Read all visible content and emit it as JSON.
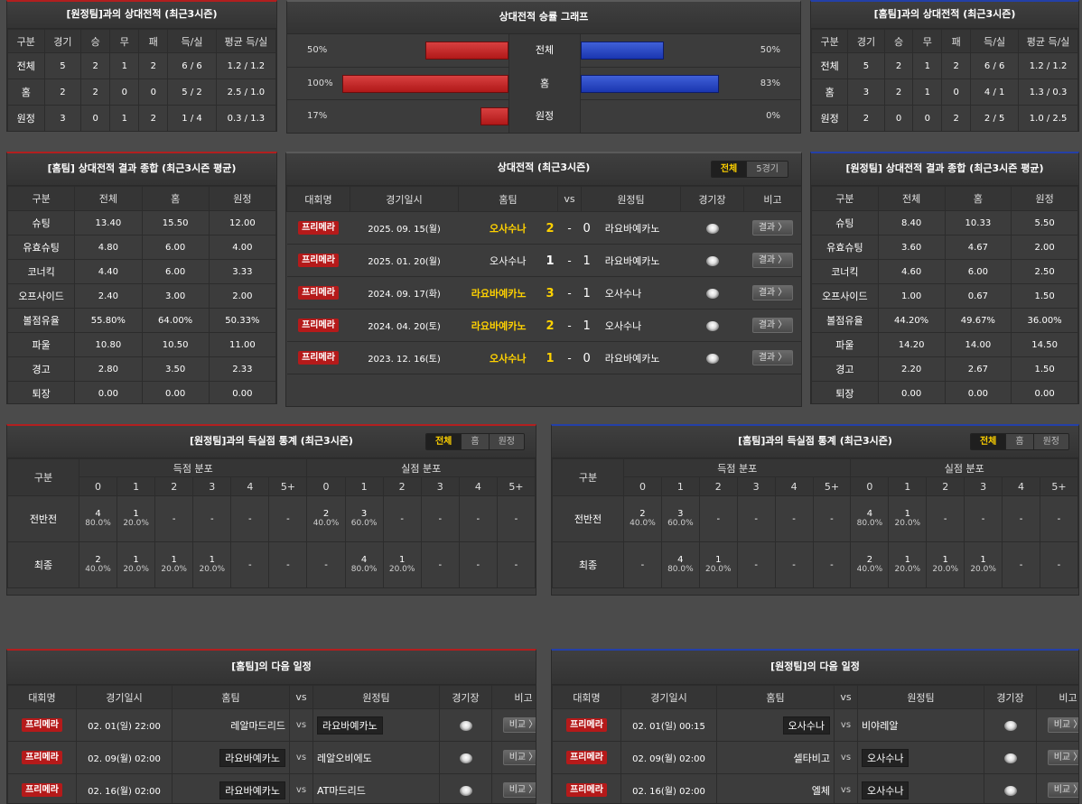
{
  "p1": {
    "title": "[원정팀]과의 상대전적 (최근3시즌)",
    "headers": [
      "구분",
      "경기",
      "승",
      "무",
      "패",
      "득/실",
      "평균 득/실"
    ],
    "rows": [
      [
        "전체",
        "5",
        "2",
        "1",
        "2",
        "6 / 6",
        "1.2 / 1.2"
      ],
      [
        "홈",
        "2",
        "2",
        "0",
        "0",
        "5 / 2",
        "2.5 / 1.0"
      ],
      [
        "원정",
        "3",
        "0",
        "1",
        "2",
        "1 / 4",
        "0.3 / 1.3"
      ]
    ]
  },
  "p2": {
    "title": "상대전적 승률 그래프",
    "rows": [
      {
        "label": "전체",
        "left": "50%",
        "right": "50%",
        "lv": 50,
        "rv": 50
      },
      {
        "label": "홈",
        "left": "100%",
        "right": "83%",
        "lv": 100,
        "rv": 83
      },
      {
        "label": "원정",
        "left": "17%",
        "right": "0%",
        "lv": 17,
        "rv": 0
      }
    ]
  },
  "p3": {
    "title": "[홈팀]과의 상대전적 (최근3시즌)",
    "headers": [
      "구분",
      "경기",
      "승",
      "무",
      "패",
      "득/실",
      "평균 득/실"
    ],
    "rows": [
      [
        "전체",
        "5",
        "2",
        "1",
        "2",
        "6 / 6",
        "1.2 / 1.2"
      ],
      [
        "홈",
        "3",
        "2",
        "1",
        "0",
        "4 / 1",
        "1.3 / 0.3"
      ],
      [
        "원정",
        "2",
        "0",
        "0",
        "2",
        "2 / 5",
        "1.0 / 2.5"
      ]
    ]
  },
  "p4": {
    "title": "[홈팀] 상대전적 결과 종합 (최근3시즌 평균)",
    "headers": [
      "구분",
      "전체",
      "홈",
      "원정"
    ],
    "rows": [
      [
        "슈팅",
        "13.40",
        "15.50",
        "12.00"
      ],
      [
        "유효슈팅",
        "4.80",
        "6.00",
        "4.00"
      ],
      [
        "코너킥",
        "4.40",
        "6.00",
        "3.33"
      ],
      [
        "오프사이드",
        "2.40",
        "3.00",
        "2.00"
      ],
      [
        "볼점유율",
        "55.80%",
        "64.00%",
        "50.33%"
      ],
      [
        "파울",
        "10.80",
        "10.50",
        "11.00"
      ],
      [
        "경고",
        "2.80",
        "3.50",
        "2.33"
      ],
      [
        "퇴장",
        "0.00",
        "0.00",
        "0.00"
      ]
    ]
  },
  "p5": {
    "title": "상대전적 (최근3시즌)",
    "tabs": [
      "전체",
      "5경기"
    ],
    "headers": [
      "대회명",
      "경기일시",
      "홈팀",
      "vs",
      "원정팀",
      "경기장",
      "비고"
    ],
    "rows": [
      {
        "league": "프리메라",
        "date": "2025. 09. 15(월)",
        "home": "오사수나",
        "score": "2",
        "dash": "-",
        "away_score": "0",
        "away": "라요바예카노",
        "home_win": true,
        "btn": "결과 〉"
      },
      {
        "league": "프리메라",
        "date": "2025. 01. 20(월)",
        "home": "오사수나",
        "score": "1",
        "dash": "-",
        "away_score": "1",
        "away": "라요바예카노",
        "home_win": false,
        "btn": "결과 〉"
      },
      {
        "league": "프리메라",
        "date": "2024. 09. 17(화)",
        "home": "라요바예카노",
        "score": "3",
        "dash": "-",
        "away_score": "1",
        "away": "오사수나",
        "home_win": true,
        "btn": "결과 〉"
      },
      {
        "league": "프리메라",
        "date": "2024. 04. 20(토)",
        "home": "라요바예카노",
        "score": "2",
        "dash": "-",
        "away_score": "1",
        "away": "오사수나",
        "home_win": true,
        "btn": "결과 〉"
      },
      {
        "league": "프리메라",
        "date": "2023. 12. 16(토)",
        "home": "오사수나",
        "score": "1",
        "dash": "-",
        "away_score": "0",
        "away": "라요바예카노",
        "home_win": true,
        "btn": "결과 〉"
      }
    ]
  },
  "p6": {
    "title": "[원정팀] 상대전적 결과 종합 (최근3시즌 평균)",
    "headers": [
      "구분",
      "전체",
      "홈",
      "원정"
    ],
    "rows": [
      [
        "슈팅",
        "8.40",
        "10.33",
        "5.50"
      ],
      [
        "유효슈팅",
        "3.60",
        "4.67",
        "2.00"
      ],
      [
        "코너킥",
        "4.60",
        "6.00",
        "2.50"
      ],
      [
        "오프사이드",
        "1.00",
        "0.67",
        "1.50"
      ],
      [
        "볼점유율",
        "44.20%",
        "49.67%",
        "36.00%"
      ],
      [
        "파울",
        "14.20",
        "14.00",
        "14.50"
      ],
      [
        "경고",
        "2.20",
        "2.67",
        "1.50"
      ],
      [
        "퇴장",
        "0.00",
        "0.00",
        "0.00"
      ]
    ]
  },
  "p7": {
    "title": "[원정팀]과의 득실점 통계 (최근3시즌)",
    "tabs": [
      "전체",
      "홈",
      "원정"
    ],
    "col0": "구분",
    "g1": "득점 분포",
    "g2": "실점 분포",
    "cols": [
      "0",
      "1",
      "2",
      "3",
      "4",
      "5+"
    ],
    "rows": [
      {
        "label": "전반전",
        "cells": [
          [
            "4",
            "80.0%"
          ],
          [
            "1",
            "20.0%"
          ],
          [
            "-",
            ""
          ],
          [
            "-",
            ""
          ],
          [
            "-",
            ""
          ],
          [
            "-",
            ""
          ],
          [
            "2",
            "40.0%"
          ],
          [
            "3",
            "60.0%"
          ],
          [
            "-",
            ""
          ],
          [
            "-",
            ""
          ],
          [
            "-",
            ""
          ],
          [
            "-",
            ""
          ]
        ]
      },
      {
        "label": "최종",
        "cells": [
          [
            "2",
            "40.0%"
          ],
          [
            "1",
            "20.0%"
          ],
          [
            "1",
            "20.0%"
          ],
          [
            "1",
            "20.0%"
          ],
          [
            "-",
            ""
          ],
          [
            "-",
            ""
          ],
          [
            "-",
            ""
          ],
          [
            "4",
            "80.0%"
          ],
          [
            "1",
            "20.0%"
          ],
          [
            "-",
            ""
          ],
          [
            "-",
            ""
          ],
          [
            "-",
            ""
          ]
        ]
      }
    ]
  },
  "p8": {
    "title": "[홈팀]과의 득실점 통계 (최근3시즌)",
    "tabs": [
      "전체",
      "홈",
      "원정"
    ],
    "col0": "구분",
    "g1": "득점 분포",
    "g2": "실점 분포",
    "cols": [
      "0",
      "1",
      "2",
      "3",
      "4",
      "5+"
    ],
    "rows": [
      {
        "label": "전반전",
        "cells": [
          [
            "2",
            "40.0%"
          ],
          [
            "3",
            "60.0%"
          ],
          [
            "-",
            ""
          ],
          [
            "-",
            ""
          ],
          [
            "-",
            ""
          ],
          [
            "-",
            ""
          ],
          [
            "4",
            "80.0%"
          ],
          [
            "1",
            "20.0%"
          ],
          [
            "-",
            ""
          ],
          [
            "-",
            ""
          ],
          [
            "-",
            ""
          ],
          [
            "-",
            ""
          ]
        ]
      },
      {
        "label": "최종",
        "cells": [
          [
            "-",
            ""
          ],
          [
            "4",
            "80.0%"
          ],
          [
            "1",
            "20.0%"
          ],
          [
            "-",
            ""
          ],
          [
            "-",
            ""
          ],
          [
            "-",
            ""
          ],
          [
            "2",
            "40.0%"
          ],
          [
            "1",
            "20.0%"
          ],
          [
            "1",
            "20.0%"
          ],
          [
            "1",
            "20.0%"
          ],
          [
            "-",
            ""
          ],
          [
            "-",
            ""
          ]
        ]
      }
    ]
  },
  "p9": {
    "title": "[홈팀]의 다음 일정",
    "headers": [
      "대회명",
      "경기일시",
      "홈팀",
      "vs",
      "원정팀",
      "경기장",
      "비고"
    ],
    "rows": [
      {
        "league": "프리메라",
        "date": "02. 01(일) 22:00",
        "home": "레알마드리드",
        "away": "라요바예카노",
        "mark": "away",
        "btn": "비교 〉"
      },
      {
        "league": "프리메라",
        "date": "02. 09(월) 02:00",
        "home": "라요바예카노",
        "away": "레알오비에도",
        "mark": "home",
        "btn": "비교 〉"
      },
      {
        "league": "프리메라",
        "date": "02. 16(월) 02:00",
        "home": "라요바예카노",
        "away": "AT마드리드",
        "mark": "home",
        "btn": "비교 〉"
      }
    ]
  },
  "p10": {
    "title": "[원정팀]의 다음 일정",
    "headers": [
      "대회명",
      "경기일시",
      "홈팀",
      "vs",
      "원정팀",
      "경기장",
      "비고"
    ],
    "rows": [
      {
        "league": "프리메라",
        "date": "02. 01(일) 00:15",
        "home": "오사수나",
        "away": "비야레알",
        "mark": "home",
        "btn": "비교 〉"
      },
      {
        "league": "프리메라",
        "date": "02. 09(월) 02:00",
        "home": "셀타비고",
        "away": "오사수나",
        "mark": "away",
        "btn": "비교 〉"
      },
      {
        "league": "프리메라",
        "date": "02. 16(월) 02:00",
        "home": "엘체",
        "away": "오사수나",
        "mark": "away",
        "btn": "비교 〉"
      }
    ]
  },
  "vs_text": "vs"
}
